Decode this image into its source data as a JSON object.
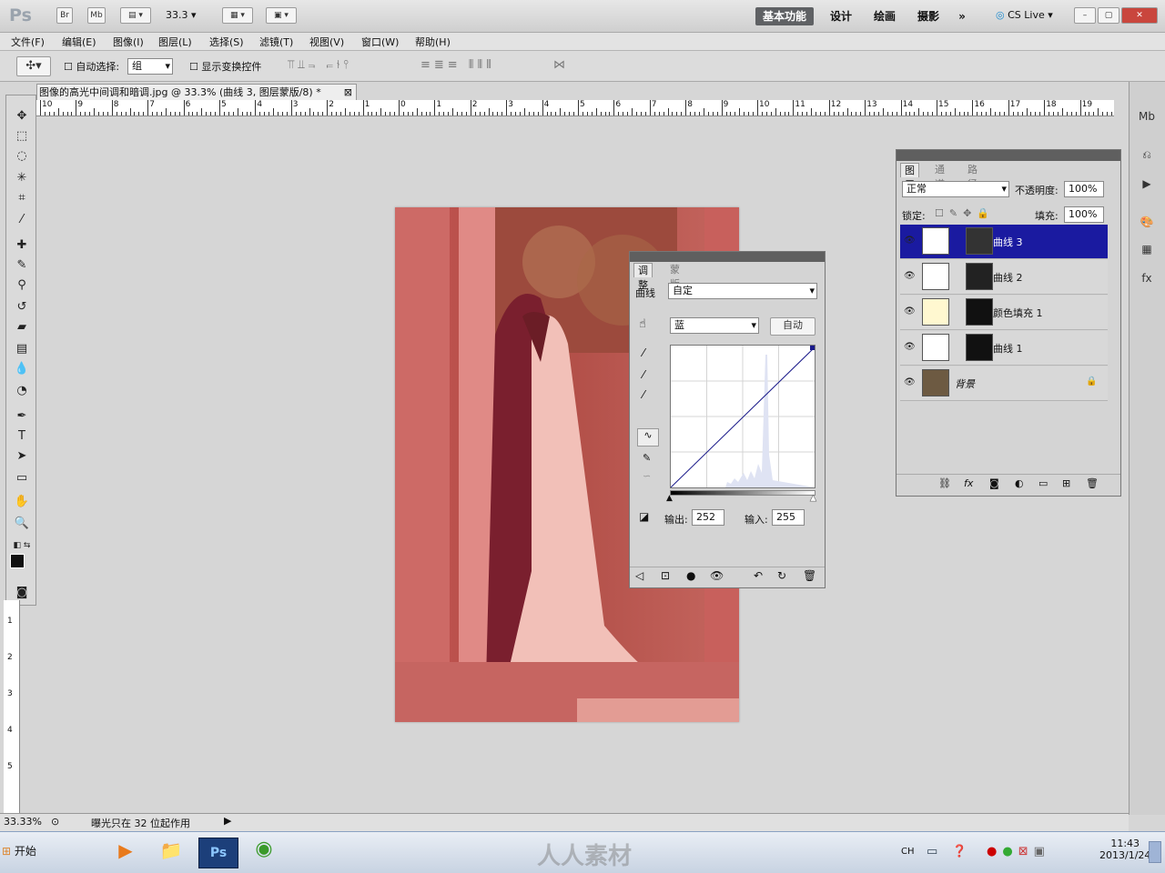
{
  "app": {
    "logo": "Ps",
    "bridge": "Br",
    "minibridge": "Mb",
    "zoom_value": "33.3",
    "workspaces": [
      "基本功能",
      "设计",
      "绘画",
      "摄影"
    ],
    "cs_live": "CS Live",
    "win_min": "–",
    "win_max": "▢",
    "win_close": "✕"
  },
  "menu": [
    "文件(F)",
    "编辑(E)",
    "图像(I)",
    "图层(L)",
    "选择(S)",
    "滤镜(T)",
    "视图(V)",
    "窗口(W)",
    "帮助(H)"
  ],
  "options": {
    "auto_select_label": "自动选择:",
    "auto_select_value": "组",
    "show_transform_label": "显示变换控件"
  },
  "document": {
    "tab_title": "图像的高光中间调和暗调.jpg @ 33.3% (曲线 3, 图层蒙版/8) *",
    "ruler_labels": [
      "10",
      "9",
      "8",
      "7",
      "6",
      "5",
      "4",
      "3",
      "2",
      "1",
      "0",
      "1",
      "2",
      "3",
      "4",
      "5",
      "6",
      "7",
      "8",
      "9",
      "10",
      "11",
      "12",
      "13",
      "14",
      "15",
      "16",
      "17",
      "18",
      "19"
    ],
    "left_ruler_labels": [
      "1",
      "2",
      "3",
      "4",
      "5"
    ]
  },
  "layers_panel": {
    "tabs": [
      "图层",
      "通道",
      "路径"
    ],
    "blend_mode": "正常",
    "opacity_label": "不透明度:",
    "opacity_value": "100%",
    "lock_label": "锁定:",
    "fill_label": "填充:",
    "fill_value": "100%",
    "layers": [
      {
        "name": "曲线 3",
        "selected": true
      },
      {
        "name": "曲线 2",
        "selected": false
      },
      {
        "name": "颜色填充 1",
        "selected": false
      },
      {
        "name": "曲线 1",
        "selected": false
      },
      {
        "name": "背景",
        "selected": false
      }
    ]
  },
  "adjust_panel": {
    "tabs": [
      "调整",
      "蒙版"
    ],
    "type_label": "曲线",
    "preset_value": "自定",
    "channel_value": "蓝",
    "auto_button": "自动",
    "output_label": "输出:",
    "output_value": "252",
    "input_label": "输入:",
    "input_value": "255"
  },
  "status": {
    "zoom": "33.33%",
    "message": "曝光只在 32 位起作用"
  },
  "taskbar": {
    "start_label": "开始",
    "ps_label": "Ps",
    "watermark": "人人素材",
    "ime": "CH",
    "time": "11:43",
    "date": "2013/1/24"
  },
  "colors": {
    "accent_selection": "#1a1aa0",
    "photo_tint": "#c85e5c",
    "curve_line": "#1a1a8a"
  }
}
